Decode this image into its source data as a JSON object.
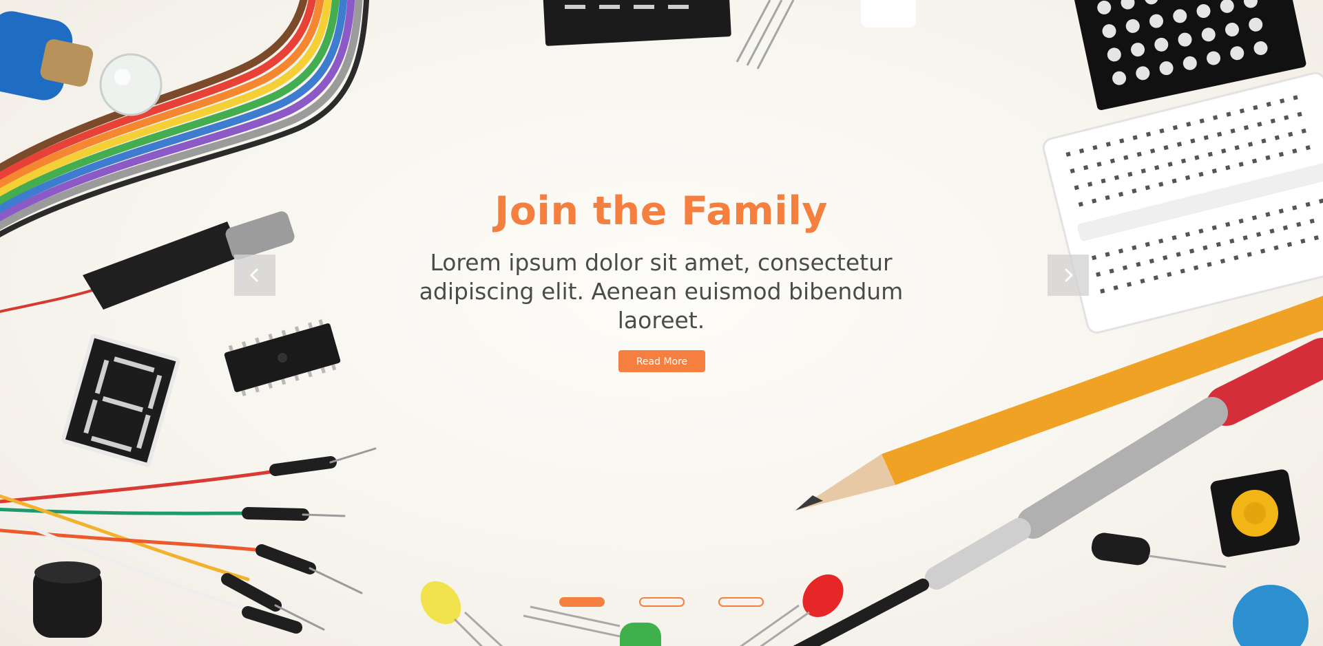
{
  "hero": {
    "title": "Join the Family",
    "description": "Lorem ipsum dolor sit amet, consectetur adipiscing elit. Aenean euismod bibendum laoreet.",
    "cta_label": "Read More"
  },
  "carousel": {
    "prev_icon": "chevron-left-icon",
    "next_icon": "chevron-right-icon",
    "indicators": [
      {
        "active": true
      },
      {
        "active": false
      },
      {
        "active": false
      }
    ]
  },
  "colors": {
    "accent": "#f47f3e",
    "body_text": "#4b4b4b",
    "background": "#fbf8f3",
    "arrow_bg": "#d2d2d2"
  }
}
